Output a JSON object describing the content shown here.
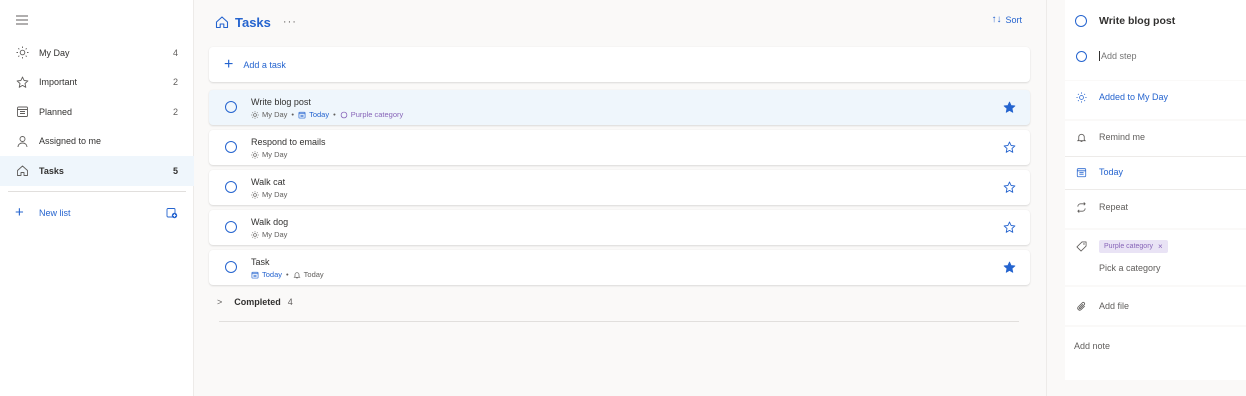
{
  "sidebar": {
    "items": [
      {
        "label": "My Day",
        "count": "4",
        "icon": "sun-icon"
      },
      {
        "label": "Important",
        "count": "2",
        "icon": "star-icon"
      },
      {
        "label": "Planned",
        "count": "2",
        "icon": "calendar-icon"
      },
      {
        "label": "Assigned to me",
        "count": "",
        "icon": "person-icon"
      },
      {
        "label": "Tasks",
        "count": "5",
        "icon": "home-icon"
      }
    ],
    "new_list_label": "New list"
  },
  "main": {
    "title": "Tasks",
    "more": "···",
    "sort_label": "Sort",
    "add_task_label": "Add a task",
    "tasks": [
      {
        "title": "Write blog post",
        "myday": "My Day",
        "due": "Today",
        "category": "Purple category",
        "important": true,
        "selected": true
      },
      {
        "title": "Respond to emails",
        "myday": "My Day",
        "important": false
      },
      {
        "title": "Walk cat",
        "myday": "My Day",
        "important": false
      },
      {
        "title": "Walk dog",
        "myday": "My Day",
        "important": false
      },
      {
        "title": "Task",
        "due": "Today",
        "reminder": "Today",
        "important": true
      }
    ],
    "completed_label": "Completed",
    "completed_count": "4"
  },
  "detail": {
    "title": "Write blog post",
    "add_step_placeholder": "Add step",
    "added_to_my_day": "Added to My Day",
    "remind_me": "Remind me",
    "due": "Today",
    "repeat": "Repeat",
    "category_chip": "Purple category",
    "chip_remove": "×",
    "pick_category": "Pick a category",
    "add_file": "Add file",
    "add_note": "Add note"
  },
  "colors": {
    "accent": "#2564cf",
    "purple": "#8764b8",
    "selected_bg": "#eff6fc"
  }
}
